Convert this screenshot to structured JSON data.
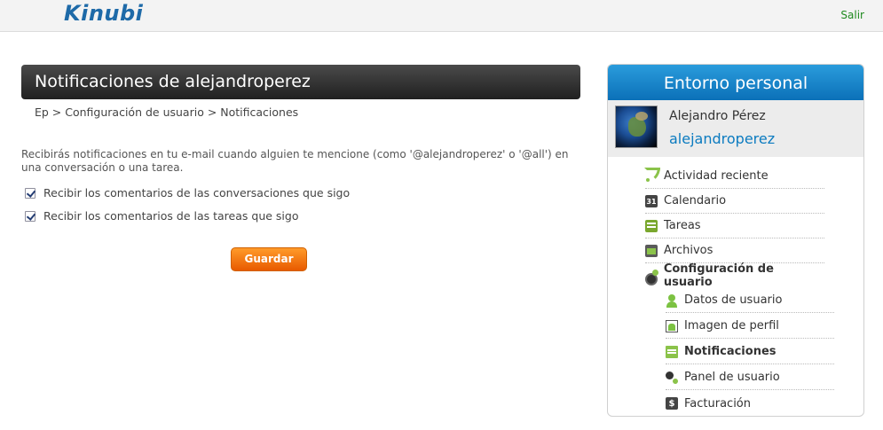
{
  "header": {
    "logo_text": "Kinubi",
    "logout_label": "Salir"
  },
  "main": {
    "title": "Notificaciones de alejandroperez",
    "breadcrumb": "Ep > Configuración de usuario > Notificaciones",
    "info_text": "Recibirás notificaciones en tu e-mail cuando alguien te mencione (como '@alejandroperez' o '@all') en una conversación o una tarea.",
    "options": [
      {
        "label": "Recibir los comentarios de las conversaciones que sigo",
        "checked": true
      },
      {
        "label": "Recibir los comentarios de las tareas que sigo",
        "checked": true
      }
    ],
    "save_label": "Guardar"
  },
  "sidebar": {
    "title": "Entorno personal",
    "user_name": "Alejandro Pérez",
    "user_handle": "alejandroperez",
    "items": [
      {
        "label": "Actividad reciente",
        "icon": "rss-icon"
      },
      {
        "label": "Calendario",
        "icon": "calendar-icon",
        "badge": "31"
      },
      {
        "label": "Tareas",
        "icon": "tasks-icon"
      },
      {
        "label": "Archivos",
        "icon": "folder-icon"
      },
      {
        "label": "Configuración de usuario",
        "icon": "gear-icon"
      }
    ],
    "subitems": [
      {
        "label": "Datos de usuario",
        "icon": "user-icon"
      },
      {
        "label": "Imagen de perfil",
        "icon": "image-icon"
      },
      {
        "label": "Notificaciones",
        "icon": "notifications-icon"
      },
      {
        "label": "Panel de usuario",
        "icon": "panel-icon"
      },
      {
        "label": "Facturación",
        "icon": "billing-icon",
        "badge": "$"
      }
    ]
  }
}
